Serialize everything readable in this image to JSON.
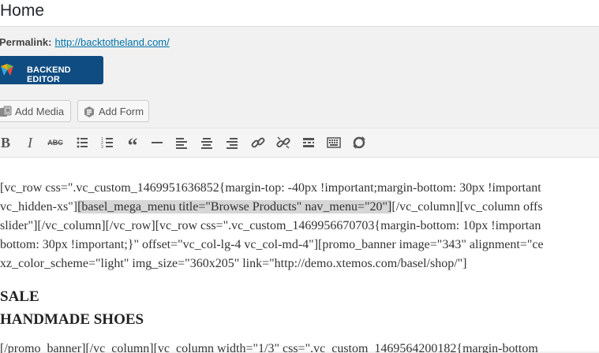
{
  "title": "Home",
  "permalink": {
    "label": "Permalink:",
    "url": "http://backtotheland.com/"
  },
  "backend_editor": {
    "label": "BACKEND EDITOR"
  },
  "media_buttons": {
    "add_media": "Add Media",
    "add_form": "Add Form"
  },
  "toolbar": {
    "items": [
      "bold-icon",
      "italic-icon",
      "strikethrough-icon",
      "bullet-list-icon",
      "numbered-list-icon",
      "blockquote-icon",
      "horizontal-line-icon",
      "align-left-icon",
      "align-center-icon",
      "align-right-icon",
      "link-icon",
      "unlink-icon",
      "read-more-icon",
      "toolbar-toggle-icon",
      "fullscreen-icon"
    ]
  },
  "editor": {
    "lines": [
      "[vc_row css=\".vc_custom_1469951636852{margin-top: -40px !important;margin-bottom: 30px !important",
      "vc_hidden-xs\"]",
      "[basel_mega_menu title=\"Browse Products\" nav_menu=\"20\"]",
      "[/vc_column][vc_column offs",
      "slider\"][/vc_column][/vc_row][vc_row css=\".vc_custom_1469956670703{margin-bottom: 10px !importan",
      "bottom: 30px !important;}\" offset=\"vc_col-lg-4 vc_col-md-4\"][promo_banner image=\"343\" alignment=\"ce",
      "xz_color_scheme=\"light\" img_size=\"360x205\" link=\"http://demo.xtemos.com/basel/shop/\"]"
    ],
    "heading1": "SALE",
    "heading2": "HANDMADE SHOES",
    "partial": "[/promo_banner][/vc_column][vc_column width=\"1/3\" css=\".vc_custom_1469564200182{margin-bottom"
  }
}
